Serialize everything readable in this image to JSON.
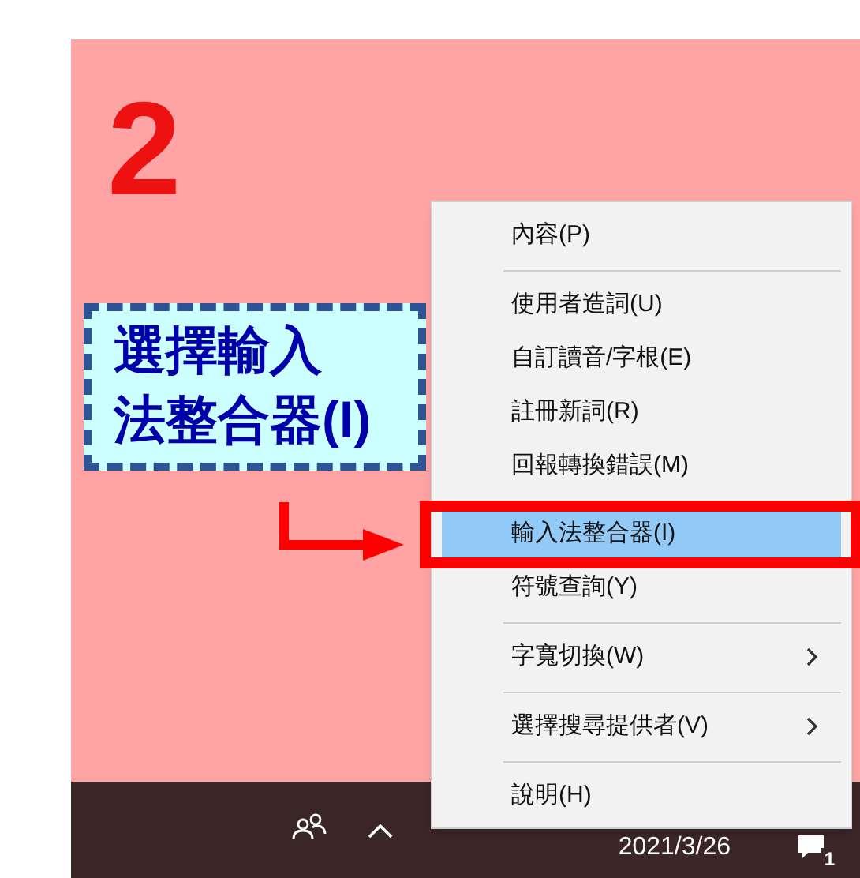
{
  "step_number": "2",
  "callout": {
    "lines": [
      "選擇輸入",
      "法整合器(I)"
    ]
  },
  "context_menu": {
    "items": [
      {
        "kind": "item",
        "label": "內容(P)",
        "selected": false,
        "submenu": false
      },
      {
        "kind": "separator"
      },
      {
        "kind": "item",
        "label": "使用者造詞(U)",
        "selected": false,
        "submenu": false
      },
      {
        "kind": "item",
        "label": "自訂讀音/字根(E)",
        "selected": false,
        "submenu": false
      },
      {
        "kind": "item",
        "label": "註冊新詞(R)",
        "selected": false,
        "submenu": false
      },
      {
        "kind": "item",
        "label": "回報轉換錯誤(M)",
        "selected": false,
        "submenu": false
      },
      {
        "kind": "item",
        "label": "輸入法整合器(I)",
        "selected": true,
        "submenu": false
      },
      {
        "kind": "item",
        "label": "符號查詢(Y)",
        "selected": false,
        "submenu": false
      },
      {
        "kind": "separator"
      },
      {
        "kind": "item",
        "label": "字寬切換(W)",
        "selected": false,
        "submenu": true
      },
      {
        "kind": "separator"
      },
      {
        "kind": "item",
        "label": "選擇搜尋提供者(V)",
        "selected": false,
        "submenu": true
      },
      {
        "kind": "separator"
      },
      {
        "kind": "item",
        "label": "說明(H)",
        "selected": false,
        "submenu": false
      }
    ]
  },
  "taskbar": {
    "date": "2021/3/26",
    "notification_count": "1"
  }
}
